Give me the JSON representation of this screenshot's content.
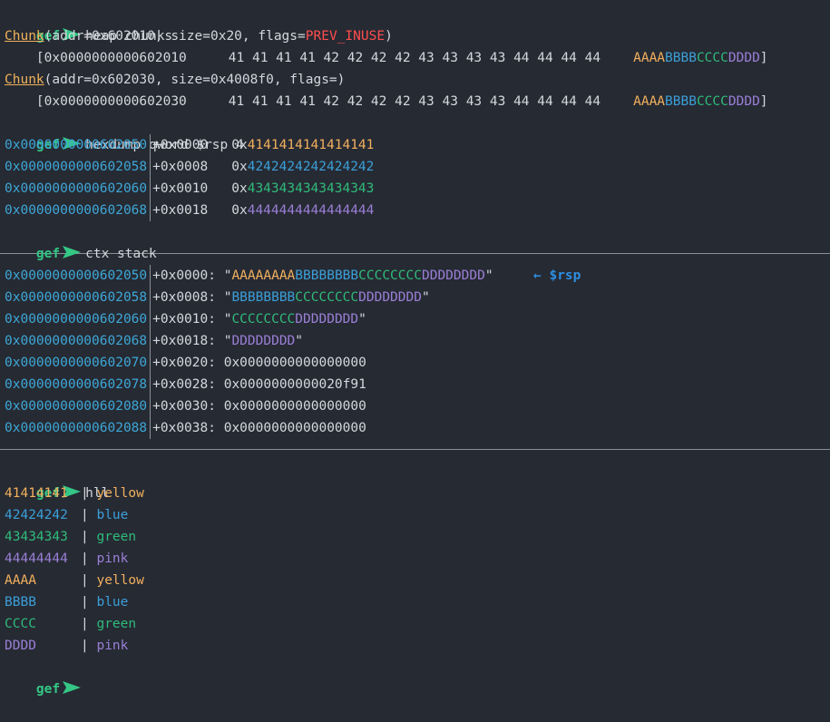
{
  "prompt": {
    "word": "gef",
    "color": "#34c785",
    "arrow_icon": "prompt-arrow-icon"
  },
  "commands": {
    "heap_chunks": "heap chunks",
    "hexdump": "hexdump qword $rsp 4",
    "ctx_stack": "ctx stack",
    "hll": "hll"
  },
  "colors": {
    "yellow": "#f2b05e",
    "blue": "#3b9fd8",
    "green": "#2fbb7a",
    "pink": "#9a7fd6",
    "address": "#3ea7d6",
    "flag": "#ff4d4d",
    "background": "#262a33"
  },
  "chunks": [
    {
      "name": "Chunk",
      "open": "(addr=0x602010, size=0x20, flags=",
      "flags": "PREV_INUSE",
      "close": ")",
      "bracket_open": "    [",
      "data_addr": "0x0000000000602010",
      "bytes": "41 41 41 41 42 42 42 42 43 43 43 43 44 44 44 44",
      "ascii": [
        "AAAA",
        "BBBB",
        "CCCC",
        "DDDD"
      ],
      "bracket_close": "]"
    },
    {
      "name": "Chunk",
      "open": "(addr=0x602030, size=0x4008f0, flags=",
      "flags": "",
      "close": ")",
      "bracket_open": "    [",
      "data_addr": "0x0000000000602030",
      "bytes": "41 41 41 41 42 42 42 42 43 43 43 43 44 44 44 44",
      "ascii": [
        "AAAA",
        "BBBB",
        "CCCC",
        "DDDD"
      ],
      "bracket_close": "]"
    }
  ],
  "hexdump": [
    {
      "addr": "0x0000000000602050",
      "offset": "+0x0000",
      "prefix": "0x",
      "value": "4141414141414141",
      "color": "yellow"
    },
    {
      "addr": "0x0000000000602058",
      "offset": "+0x0008",
      "prefix": "0x",
      "value": "4242424242424242",
      "color": "blue"
    },
    {
      "addr": "0x0000000000602060",
      "offset": "+0x0010",
      "prefix": "0x",
      "value": "4343434343434343",
      "color": "green"
    },
    {
      "addr": "0x0000000000602068",
      "offset": "+0x0018",
      "prefix": "0x",
      "value": "4444444444444444",
      "color": "pink"
    }
  ],
  "stack": {
    "rsp_label": "← $rsp",
    "rows": [
      {
        "addr": "0x0000000000602050",
        "offset": "+0x0000: ",
        "parts": [
          {
            "text": "\"",
            "color": ""
          },
          {
            "text": "AAAAAAAA",
            "color": "yellow"
          },
          {
            "text": "BBBBBBBB",
            "color": "blue"
          },
          {
            "text": "CCCCCCCC",
            "color": "green"
          },
          {
            "text": "DDDDDDDD",
            "color": "pink"
          },
          {
            "text": "\"",
            "color": ""
          }
        ]
      },
      {
        "addr": "0x0000000000602058",
        "offset": "+0x0008: ",
        "parts": [
          {
            "text": "\"",
            "color": ""
          },
          {
            "text": "BBBBBBBB",
            "color": "blue"
          },
          {
            "text": "CCCCCCCC",
            "color": "green"
          },
          {
            "text": "DDDDDDDD",
            "color": "pink"
          },
          {
            "text": "\"",
            "color": ""
          }
        ]
      },
      {
        "addr": "0x0000000000602060",
        "offset": "+0x0010: ",
        "parts": [
          {
            "text": "\"",
            "color": ""
          },
          {
            "text": "CCCCCCCC",
            "color": "green"
          },
          {
            "text": "DDDDDDDD",
            "color": "pink"
          },
          {
            "text": "\"",
            "color": ""
          }
        ]
      },
      {
        "addr": "0x0000000000602068",
        "offset": "+0x0018: ",
        "parts": [
          {
            "text": "\"",
            "color": ""
          },
          {
            "text": "DDDDDDDD",
            "color": "pink"
          },
          {
            "text": "\"",
            "color": ""
          }
        ]
      },
      {
        "addr": "0x0000000000602070",
        "offset": "+0x0020: ",
        "parts": [
          {
            "text": "0x0000000000000000",
            "color": ""
          }
        ]
      },
      {
        "addr": "0x0000000000602078",
        "offset": "+0x0028: ",
        "parts": [
          {
            "text": "0x0000000000020f91",
            "color": ""
          }
        ]
      },
      {
        "addr": "0x0000000000602080",
        "offset": "+0x0030: ",
        "parts": [
          {
            "text": "0x0000000000000000",
            "color": ""
          }
        ]
      },
      {
        "addr": "0x0000000000602088",
        "offset": "+0x0038: ",
        "parts": [
          {
            "text": "0x0000000000000000",
            "color": ""
          }
        ]
      }
    ]
  },
  "hll": [
    {
      "key": "41414141",
      "sep": "| ",
      "name": "yellow",
      "color": "yellow"
    },
    {
      "key": "42424242",
      "sep": "| ",
      "name": "blue",
      "color": "blue"
    },
    {
      "key": "43434343",
      "sep": "| ",
      "name": "green",
      "color": "green"
    },
    {
      "key": "44444444",
      "sep": "| ",
      "name": "pink",
      "color": "pink"
    },
    {
      "key": "AAAA",
      "sep": "| ",
      "name": "yellow",
      "color": "yellow"
    },
    {
      "key": "BBBB",
      "sep": "| ",
      "name": "blue",
      "color": "blue"
    },
    {
      "key": "CCCC",
      "sep": "| ",
      "name": "green",
      "color": "green"
    },
    {
      "key": "DDDD",
      "sep": "| ",
      "name": "pink",
      "color": "pink"
    }
  ]
}
